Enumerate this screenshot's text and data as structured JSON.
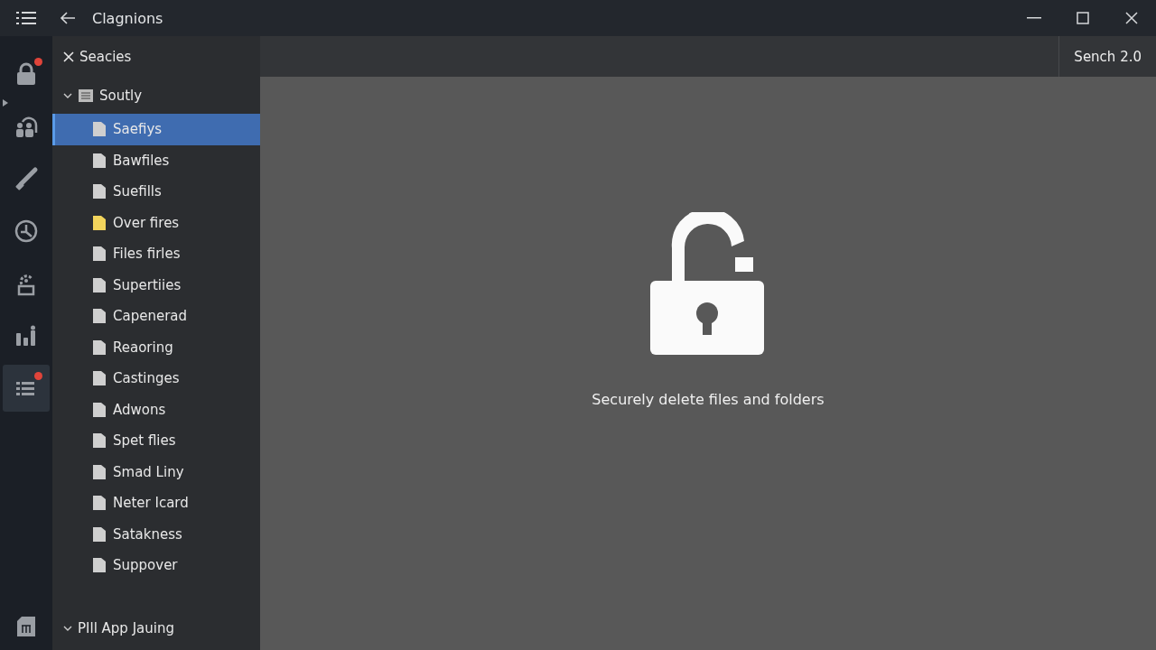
{
  "window": {
    "title": "Clagnions"
  },
  "rail": [
    {
      "kind": "lock",
      "selected": false,
      "badge": true
    },
    {
      "kind": "people",
      "selected": false,
      "badge": false
    },
    {
      "kind": "wrench",
      "selected": false,
      "badge": false
    },
    {
      "kind": "clock",
      "selected": false,
      "badge": false
    },
    {
      "kind": "gear",
      "selected": false,
      "badge": false
    },
    {
      "kind": "chart",
      "selected": false,
      "badge": false
    },
    {
      "kind": "list",
      "selected": true,
      "badge": true
    }
  ],
  "panel": {
    "title": "Seacies",
    "groups": [
      {
        "label": "Soutly",
        "expanded": true,
        "children": [
          {
            "label": "Saefiys",
            "kind": "file",
            "selected": true
          },
          {
            "label": "Bawfiles",
            "kind": "file",
            "selected": false
          },
          {
            "label": "Suefills",
            "kind": "file",
            "selected": false
          },
          {
            "label": "Over fires",
            "kind": "folder",
            "selected": false
          },
          {
            "label": "Files firles",
            "kind": "file",
            "selected": false
          },
          {
            "label": "Supertiies",
            "kind": "file",
            "selected": false
          },
          {
            "label": "Capenerad",
            "kind": "file",
            "selected": false
          },
          {
            "label": "Reaoring",
            "kind": "file",
            "selected": false
          },
          {
            "label": "Castinges",
            "kind": "file",
            "selected": false
          },
          {
            "label": "Adwons",
            "kind": "file",
            "selected": false
          },
          {
            "label": "Spet flies",
            "kind": "file",
            "selected": false
          },
          {
            "label": "Smad Liny",
            "kind": "file",
            "selected": false
          },
          {
            "label": "Neter Icard",
            "kind": "file",
            "selected": false
          },
          {
            "label": "Satakness",
            "kind": "file",
            "selected": false
          },
          {
            "label": "Suppover",
            "kind": "file",
            "selected": false
          }
        ]
      },
      {
        "label": "PIll App Jauing",
        "expanded": true
      }
    ]
  },
  "toolbar": {
    "version": "Sench 2.0"
  },
  "main": {
    "message": "Securely delete files and folders"
  }
}
